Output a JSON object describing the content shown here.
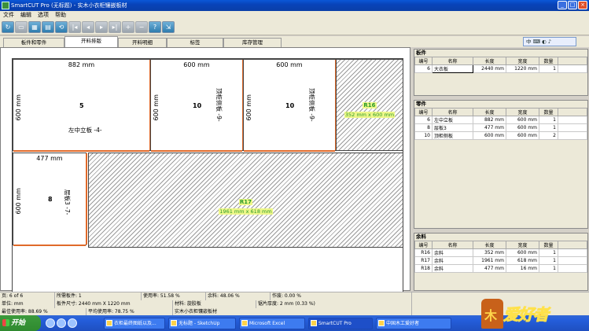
{
  "window": {
    "title": "SmartCUT Pro (无标题) - 实木小衣柜镶嵌板材",
    "minimize": "_",
    "maximize": "□",
    "close": "×"
  },
  "menu": [
    "文件",
    "编辑",
    "选项",
    "帮助"
  ],
  "toolbar": {
    "buttons": [
      "new-icon",
      "open-icon",
      "save-icon",
      "print-icon",
      "undo-icon",
      "first-icon",
      "prev-icon",
      "next-icon",
      "last-icon",
      "add-icon",
      "remove-icon",
      "help-icon",
      "exit-icon"
    ]
  },
  "tabs": [
    "板件和零件",
    "开料排版",
    "开料明细",
    "标签",
    "库存管理"
  ],
  "active_tab": "开料排版",
  "langbar": "中 ⌨ ◐ ♪",
  "layout": {
    "parts": [
      {
        "w": "882 mm",
        "h": "600 mm",
        "qty": "5",
        "name": "左中立板 -4-"
      },
      {
        "w": "600 mm",
        "h": "600 mm",
        "qty": "10",
        "name": "顶柜侧板 -9-"
      },
      {
        "w": "600 mm",
        "h": "600 mm",
        "qty": "10",
        "name": "顶柜侧板 -9-"
      },
      {
        "w": "477 mm",
        "h": "600 mm",
        "qty": "8",
        "name": "层板3 -7-"
      }
    ],
    "remnants": [
      {
        "label": "R16",
        "size": "352 mm x 600 mm"
      },
      {
        "label": "R17",
        "size": "1961 mm x 618 mm"
      }
    ]
  },
  "boards_panel": {
    "title": "板件",
    "headers": [
      "编号",
      "名称",
      "长度",
      "宽度",
      "数量"
    ],
    "rows": [
      [
        "6",
        "大衣板",
        "2440 mm",
        "1220 mm",
        "1"
      ]
    ]
  },
  "parts_panel": {
    "title": "零件",
    "headers": [
      "编号",
      "名称",
      "长度",
      "宽度",
      "数量"
    ],
    "rows": [
      [
        "6",
        "左中立板",
        "882 mm",
        "600 mm",
        "1"
      ],
      [
        "8",
        "层板3",
        "477 mm",
        "600 mm",
        "1"
      ],
      [
        "10",
        "顶柜侧板",
        "600 mm",
        "600 mm",
        "2"
      ]
    ]
  },
  "remnants_panel": {
    "title": "余料",
    "headers": [
      "编号",
      "名称",
      "长度",
      "宽度",
      "数量"
    ],
    "rows": [
      [
        "R16",
        "余料",
        "352 mm",
        "600 mm",
        "1"
      ],
      [
        "R17",
        "余料",
        "1961 mm",
        "618 mm",
        "1"
      ],
      [
        "R18",
        "余料",
        "477 mm",
        "16 mm",
        "1"
      ]
    ]
  },
  "status": {
    "row1": [
      "页: 6 of 6",
      "所需板件: 1",
      "使用率: 51.58 %",
      "余料: 48.06 %",
      "作废: 0.00 %"
    ],
    "row2": [
      "单位: mm",
      "板件尺寸: 2440 mm X 1220 mm",
      "材料: 旋胶板",
      "锯片厚度: 2 mm    (0.33 %)"
    ],
    "row3": [
      "最佳使用率: 88.69 %",
      "平均使用率: 78.75 %",
      "实木小衣柜镶嵌板材"
    ]
  },
  "taskbar": {
    "start": "开始",
    "tasks": [
      "衣柜最终图纸以及...",
      "无标题 - SketchUp",
      "Microsoft Excel",
      "SmartCUT Pro",
      "中国木工爱好者"
    ]
  },
  "watermark": {
    "mascot": "木",
    "word": "爱好者"
  }
}
